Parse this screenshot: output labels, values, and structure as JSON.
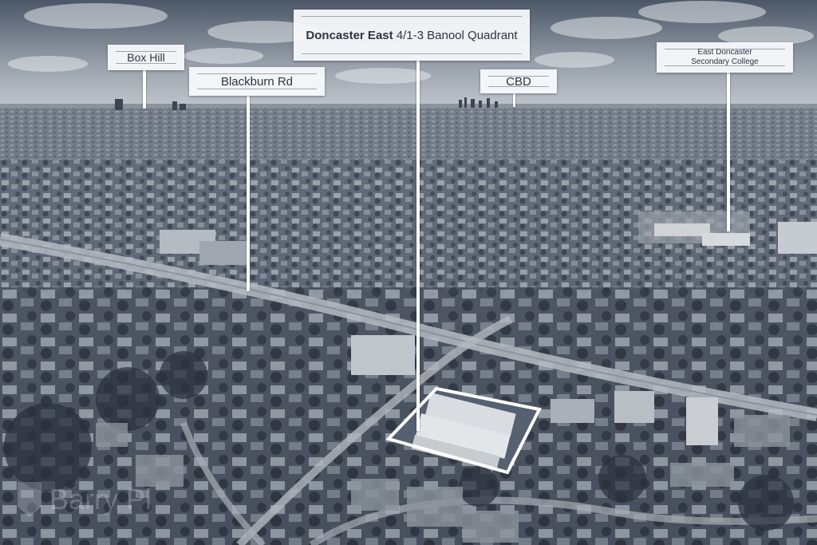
{
  "labels": {
    "box_hill": "Box Hill",
    "blackburn_rd": "Blackburn Rd",
    "main_bold": "Doncaster East",
    "main_rest": " 4/1-3 Banool Quadrant",
    "cbd": "CBD",
    "college_line1": "East Doncaster",
    "college_line2": "Secondary College"
  },
  "watermark": {
    "text": "Barry Pl"
  },
  "colors": {
    "label_bg": "#f8fafc",
    "label_text": "#2a3441",
    "pole": "#ffffff",
    "site_outline": "#ffffff",
    "image_tint": "#3f4a5c"
  }
}
